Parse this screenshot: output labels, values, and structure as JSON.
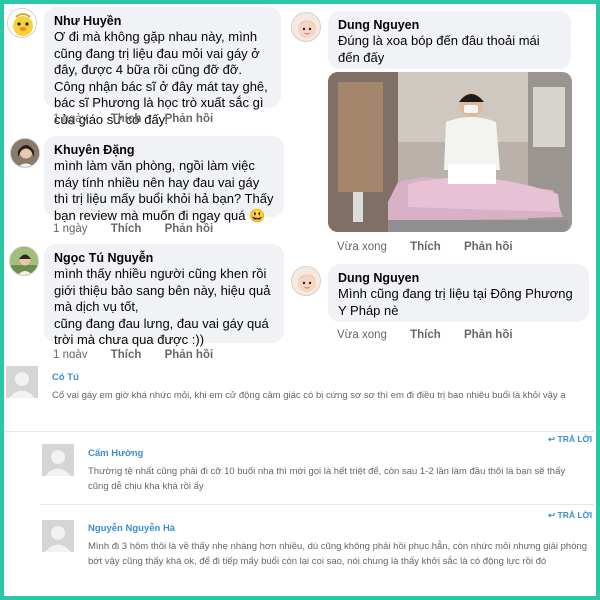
{
  "actions": {
    "time": "1 ngày",
    "like": "Thích",
    "reply": "Phản hồi",
    "time_recent": "Vừa xong"
  },
  "fb_comments": [
    {
      "name": "Như Huyền",
      "text": "Ơ đi mà không gặp nhau này, mình cũng đang trị liệu đau mỏi vai gáy ở đây, được 4 bữa rồi cũng đỡ đỡ. Công nhận bác sĩ ở đây mát tay ghê, bác sĩ Phương là học trò xuất sắc gì của giáo sư cơ đấy."
    },
    {
      "name": "Khuyên Đặng",
      "text": "mình làm văn phòng, ngồi làm việc máy tính nhiều nên hay đau vai gáy thì trị liệu mấy buổi khỏi hả bạn? Thấy bạn review mà muốn đi ngay quá",
      "emoji": "😃"
    },
    {
      "name": "Ngọc Tú Nguyễn",
      "text": "mình thấy nhiều người cũng khen rồi giới thiệu bảo sang bên này, hiệu quả mà dịch vụ tốt,\ncũng đang đau lưng, đau vai gáy quá trời mà chưa qua được :))"
    },
    {
      "name": "Dung Nguyen",
      "text": "Đúng là xoa bóp đến đâu thoải mái đến đấy"
    },
    {
      "name": "Dung Nguyen",
      "text": "Mình cũng đang trị liệu tại Đông Phương Y Pháp nè"
    }
  ],
  "wp_comments": [
    {
      "name": "Cô Tú",
      "text": "Cổ vai gáy em giờ khá nhức mỏi, khi em cử động cảm giác có bị cứng sơ sơ thì em đi điều trị bao nhiêu buổi là khỏi vậy ạ",
      "reply_label": "TRẢ LỜI"
    },
    {
      "name": "Cẩm Hường",
      "text": "Thường tệ nhất cũng phải đi cỡ 10 buổi nha thì mới gọi là hết triệt để, còn sau 1-2 lần làm đầu thôi là bạn sẽ thấy cũng dễ chịu kha khá rồi ấy",
      "reply_label": "TRẢ LỜI"
    },
    {
      "name": "Nguyễn Nguyễn Hà",
      "text": "Mình đi 3 hôm thôi là về thấy nhẹ nhàng hơn nhiều, dù cũng không phải hồi phục hẳn, còn nhức mỏi nhưng giải phóng bớt vậy cũng thấy khá ok, để đi tiếp mấy buổi còn lại coi sao, nói chung là thấy khởi sắc là có động lực rồi đó",
      "reply_label": "TRẢ LỜI"
    }
  ],
  "colors": {
    "bubble_bg": "#f0f2f5",
    "frame": "#2cc6a8",
    "wp_name": "#3a8fd0",
    "meta_text": "#65676b"
  }
}
